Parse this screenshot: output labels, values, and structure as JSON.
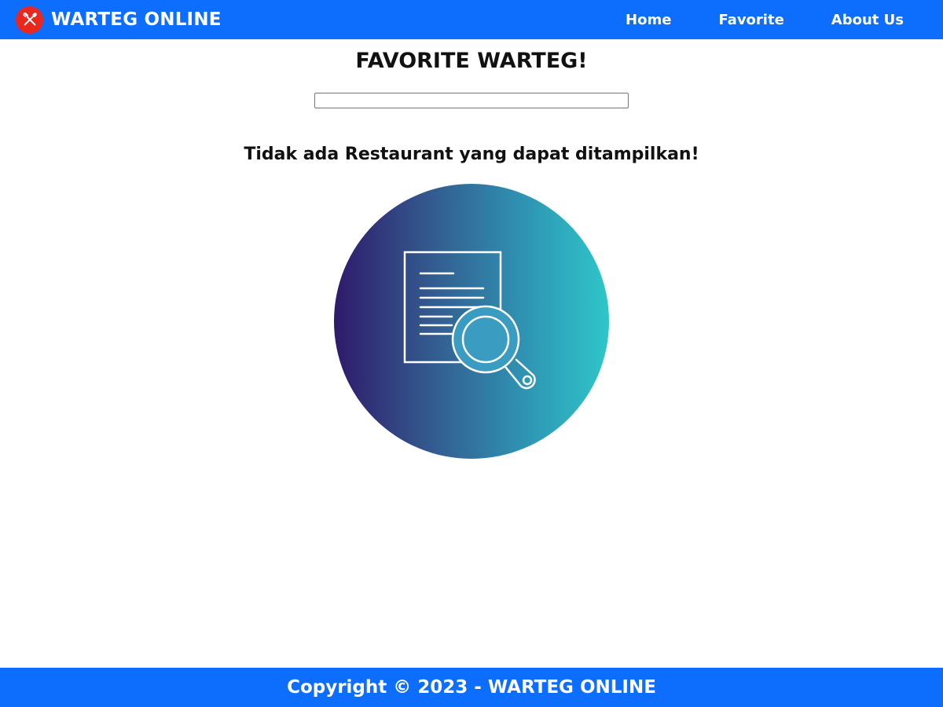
{
  "header": {
    "brand_name": "WARTEG ONLINE",
    "brand_icon": "utensils-icon",
    "nav": [
      {
        "label": "Home"
      },
      {
        "label": "Favorite"
      },
      {
        "label": "About Us"
      }
    ]
  },
  "main": {
    "title": "FAVORITE WARTEG!",
    "search": {
      "value": "",
      "placeholder": ""
    },
    "empty_message": "Tidak ada Restaurant yang dapat ditampilkan!",
    "empty_icon": "document-search-icon"
  },
  "footer": {
    "text": "Copyright © 2023 - WARTEG ONLINE"
  },
  "colors": {
    "primary": "#0d6efd",
    "logo_bg": "#e8281e",
    "gradient_start": "#2f1a6b",
    "gradient_end": "#2fc6c9"
  }
}
